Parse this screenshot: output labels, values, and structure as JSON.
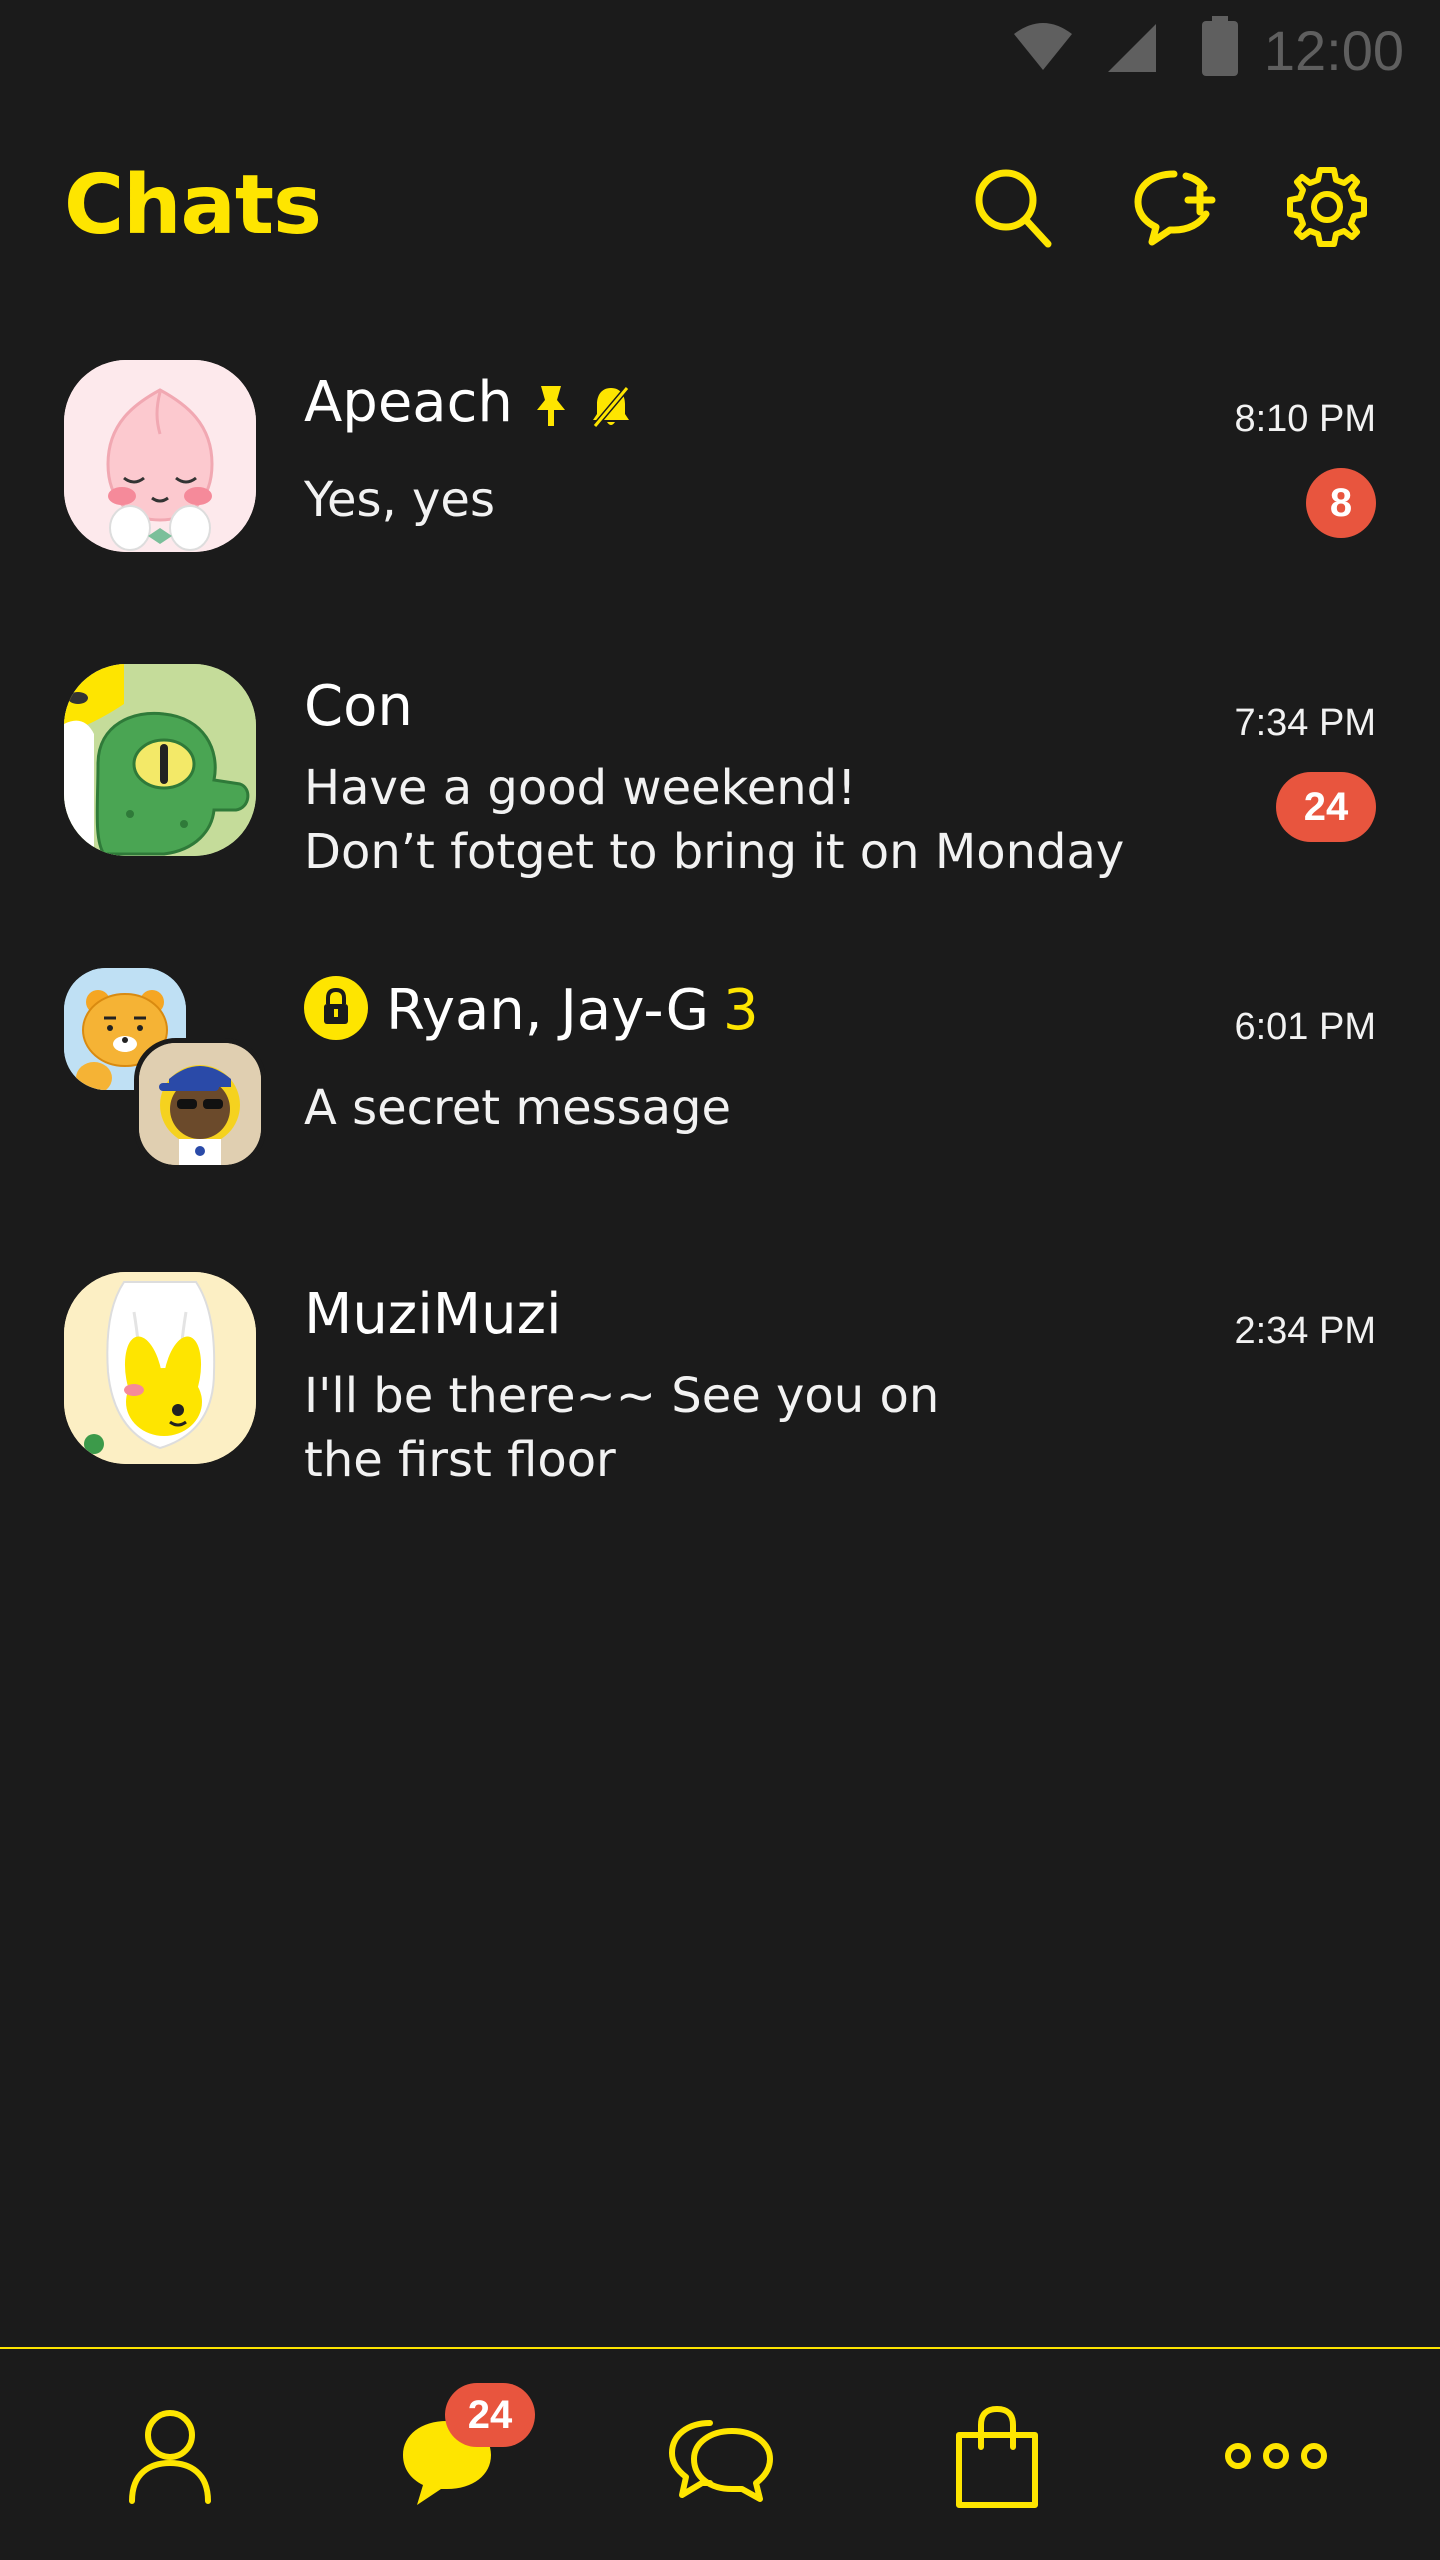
{
  "status_bar": {
    "time": "12:00",
    "icons": [
      "wifi-icon",
      "cell-signal-icon",
      "battery-icon"
    ]
  },
  "header": {
    "title": "Chats",
    "actions": [
      "search-icon",
      "new-chat-icon",
      "settings-icon"
    ]
  },
  "colors": {
    "background": "#1b1b1b",
    "accent": "#fee500",
    "badge": "#e8553e",
    "text": "#ffffff"
  },
  "chats": [
    {
      "name": "Apeach",
      "icons": [
        "pin-icon",
        "mute-icon"
      ],
      "message": "Yes, yes",
      "time": "8:10 PM",
      "unread": "8"
    },
    {
      "name": "Con",
      "message_line1": "Have a good weekend!",
      "message_line2": "Don’t fotget to bring it on Monday",
      "time": "7:34 PM",
      "unread": "24"
    },
    {
      "name": "Ryan, Jay-G",
      "member_count": "3",
      "icons": [
        "lock-icon"
      ],
      "message": "A secret message",
      "time": "6:01 PM"
    },
    {
      "name": "MuziMuzi",
      "message_line1": "I'll be there~~ See you on",
      "message_line2": "the first floor",
      "time": "2:34 PM"
    }
  ],
  "bottom_nav": {
    "items": [
      "friends-icon",
      "chats-icon",
      "openchat-icon",
      "shopping-icon",
      "more-icon"
    ],
    "chats_badge": "24"
  }
}
